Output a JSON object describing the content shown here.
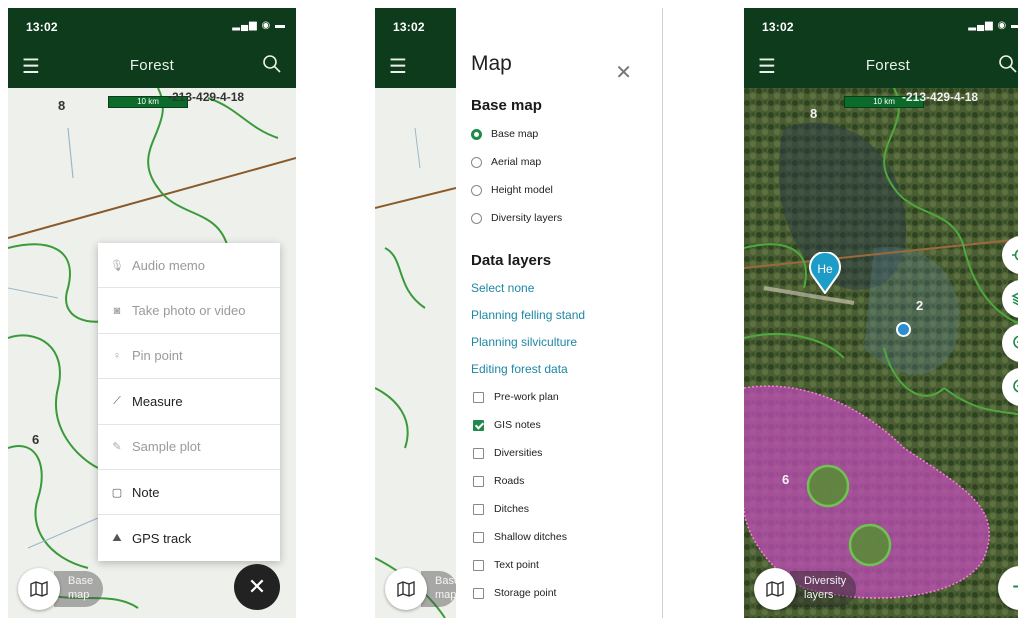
{
  "status": {
    "time": "13:02"
  },
  "app": {
    "title": "Forest"
  },
  "map_labels": {
    "stand_id": "-213-429-4-18",
    "scale": "10 km",
    "compartment_8": "8",
    "compartment_6": "6",
    "compartment_2": "2"
  },
  "basemap_button": {
    "line1": "Base",
    "line2": "map"
  },
  "diversity_button": {
    "line1": "Diversity",
    "line2": "layers"
  },
  "pin_label": "He",
  "action_menu": {
    "items": [
      {
        "label": "Audio memo",
        "icon": "microphone-icon",
        "enabled": false
      },
      {
        "label": "Take photo or video",
        "icon": "camera-icon",
        "enabled": false
      },
      {
        "label": "Pin point",
        "icon": "pin-icon",
        "enabled": false
      },
      {
        "label": "Measure",
        "icon": "ruler-icon",
        "enabled": true
      },
      {
        "label": "Sample plot",
        "icon": "pencil-icon",
        "enabled": false
      },
      {
        "label": "Note",
        "icon": "note-icon",
        "enabled": true
      },
      {
        "label": "GPS track",
        "icon": "track-icon",
        "enabled": true
      }
    ]
  },
  "map_panel": {
    "title": "Map",
    "base_map_heading": "Base map",
    "base_maps": [
      {
        "label": "Base map",
        "selected": true
      },
      {
        "label": "Aerial map",
        "selected": false
      },
      {
        "label": "Height model",
        "selected": false
      },
      {
        "label": "Diversity layers",
        "selected": false
      }
    ],
    "data_layers_heading": "Data layers",
    "links": [
      "Select none",
      "Planning felling stand",
      "Planning silviculture",
      "Editing forest data"
    ],
    "layers": [
      {
        "label": "Pre-work plan",
        "checked": false
      },
      {
        "label": "GIS notes",
        "checked": true
      },
      {
        "label": "Diversities",
        "checked": false
      },
      {
        "label": "Roads",
        "checked": false
      },
      {
        "label": "Ditches",
        "checked": false
      },
      {
        "label": "Shallow ditches",
        "checked": false
      },
      {
        "label": "Text point",
        "checked": false
      },
      {
        "label": "Storage point",
        "checked": false
      }
    ]
  },
  "colors": {
    "header": "#0d3b1b",
    "accent": "#1f8a4c",
    "link": "#1d88a3",
    "boundary": "#3a9a3a"
  }
}
